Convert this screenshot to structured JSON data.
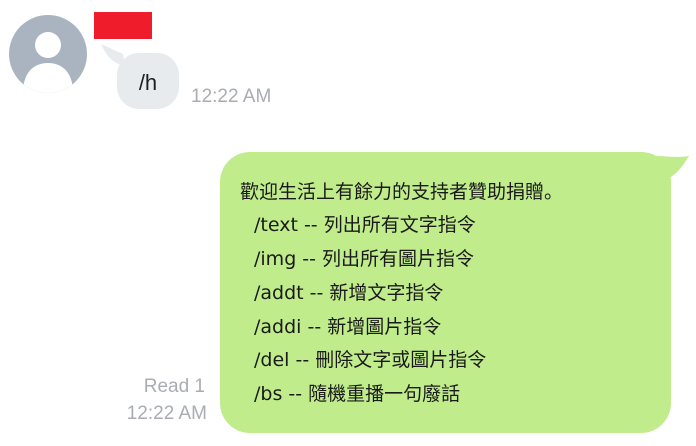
{
  "incoming": {
    "avatar_icon": "user-silhouette-icon",
    "text": "/h",
    "time": "12:22 AM"
  },
  "outgoing": {
    "lines": [
      "歡迎生活上有餘力的支持者贊助捐贈。",
      "/text -- 列出所有文字指令",
      "/img -- 列出所有圖片指令",
      "/addt -- 新增文字指令",
      "/addi -- 新增圖片指令",
      "/del -- 刪除文字或圖片指令",
      "/bs -- 隨機重播一句廢話"
    ],
    "read_status": "Read 1",
    "time": "12:22 AM"
  },
  "colors": {
    "outgoing_bubble": "#c1ec8b",
    "incoming_bubble": "#e8ebee",
    "avatar_bg": "#a9b4c0",
    "name_redaction": "#ef1d2c",
    "timestamp": "#a9adb2"
  }
}
